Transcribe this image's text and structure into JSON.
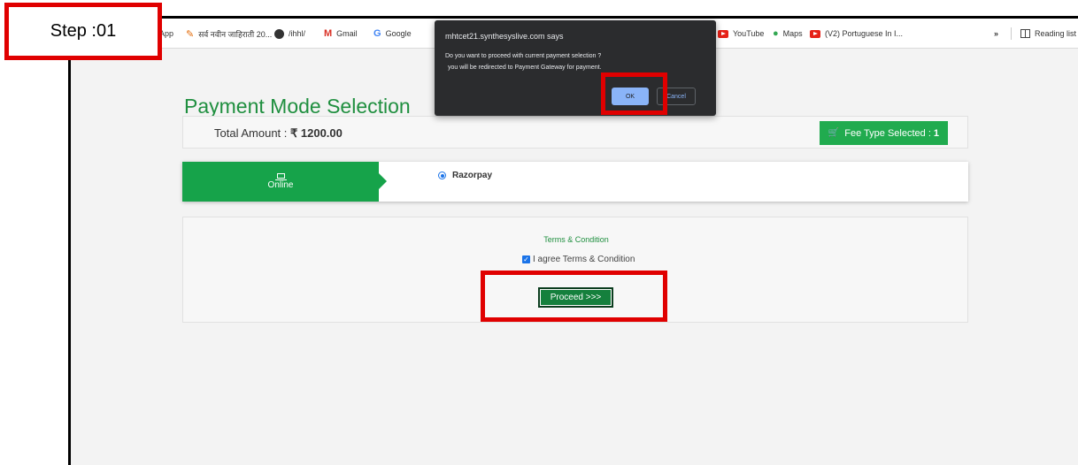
{
  "step": {
    "label": "Step :01"
  },
  "bookmarks": {
    "items": [
      {
        "icon": "apps-icon",
        "label": "App"
      },
      {
        "icon": "star-icon",
        "label": "सर्व नवीन जाहिराती 20..."
      },
      {
        "icon": "globe-icon",
        "label": "/ihhl/"
      },
      {
        "icon": "gmail-icon",
        "label": "Gmail"
      },
      {
        "icon": "google-icon",
        "label": "Google"
      },
      {
        "icon": "youtube-icon",
        "label": "YouTube"
      },
      {
        "icon": "maps-icon",
        "label": "Maps"
      },
      {
        "icon": "youtube-icon",
        "label": "(V2) Portuguese In I..."
      }
    ],
    "overflow": "»",
    "reading_list": "Reading list"
  },
  "dialog": {
    "title": "mhtcet21.synthesyslive.com says",
    "message_line1": "Do you want to proceed with current payment selection ?",
    "message_line2": "you will be redirected to Payment Gateway for payment.",
    "ok_label": "OK",
    "cancel_label": "Cancel"
  },
  "page": {
    "title": "Payment Mode Selection",
    "total_amount_label": "Total Amount : ",
    "total_amount_value": "₹ 1200.00",
    "fee_type_label": "Fee Type Selected :",
    "fee_type_count": "1",
    "mode_tab": "Online",
    "payment_option": "Razorpay",
    "terms_link": "Terms & Condition",
    "agree_label": "I agree Terms & Condition",
    "proceed_label": "Proceed >>>"
  },
  "colors": {
    "highlight": "#e00000",
    "brand_green": "#16a34a",
    "title_green": "#1f8f3f",
    "dialog_bg": "#2b2c2e",
    "ok_blue": "#8ab4f8"
  }
}
